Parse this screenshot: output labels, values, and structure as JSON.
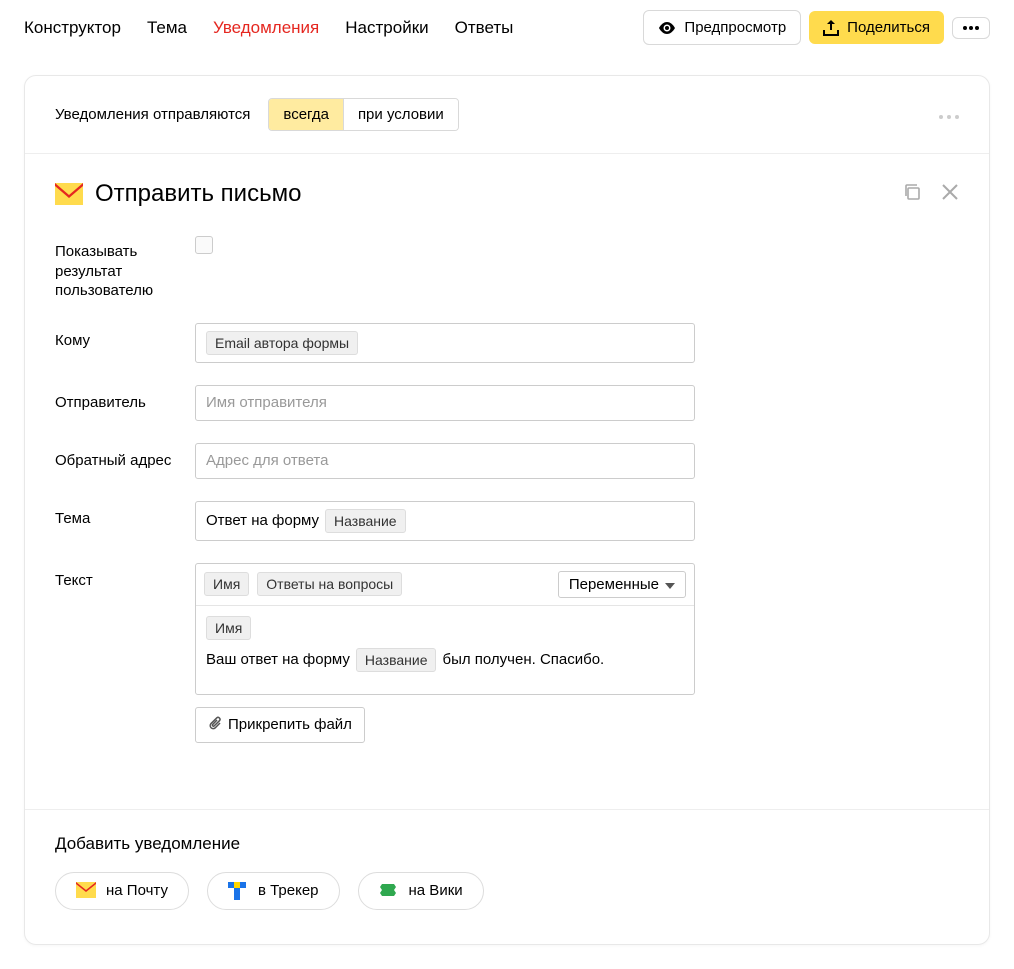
{
  "nav": {
    "tabs": [
      "Конструктор",
      "Тема",
      "Уведомления",
      "Настройки",
      "Ответы"
    ],
    "active_index": 2,
    "preview": "Предпросмотр",
    "share": "Поделиться"
  },
  "header": {
    "label": "Уведомления отправляются",
    "toggle": {
      "always": "всегда",
      "conditional": "при условии",
      "active": "always"
    }
  },
  "card": {
    "title": "Отправить письмо"
  },
  "form": {
    "show_result_label": "Показывать результат пользователю",
    "to_label": "Кому",
    "to_chip": "Email автора формы",
    "sender_label": "Отправитель",
    "sender_placeholder": "Имя отправителя",
    "reply_label": "Обратный адрес",
    "reply_placeholder": "Адрес для ответа",
    "subject_label": "Тема",
    "subject_prefix": "Ответ на форму",
    "subject_chip": "Название",
    "text_label": "Текст",
    "toolbar_chips": [
      "Имя",
      "Ответы на вопросы"
    ],
    "variables_label": "Переменные",
    "body_chip_line1": "Имя",
    "body_line2_pre": "Ваш ответ на форму",
    "body_line2_chip": "Название",
    "body_line2_post": "был получен. Спасибо.",
    "attach_label": "Прикрепить файл"
  },
  "footer": {
    "title": "Добавить уведомление",
    "buttons": [
      {
        "label": "на Почту",
        "icon": "mail"
      },
      {
        "label": "в Трекер",
        "icon": "tracker"
      },
      {
        "label": "на Вики",
        "icon": "wiki"
      }
    ]
  }
}
